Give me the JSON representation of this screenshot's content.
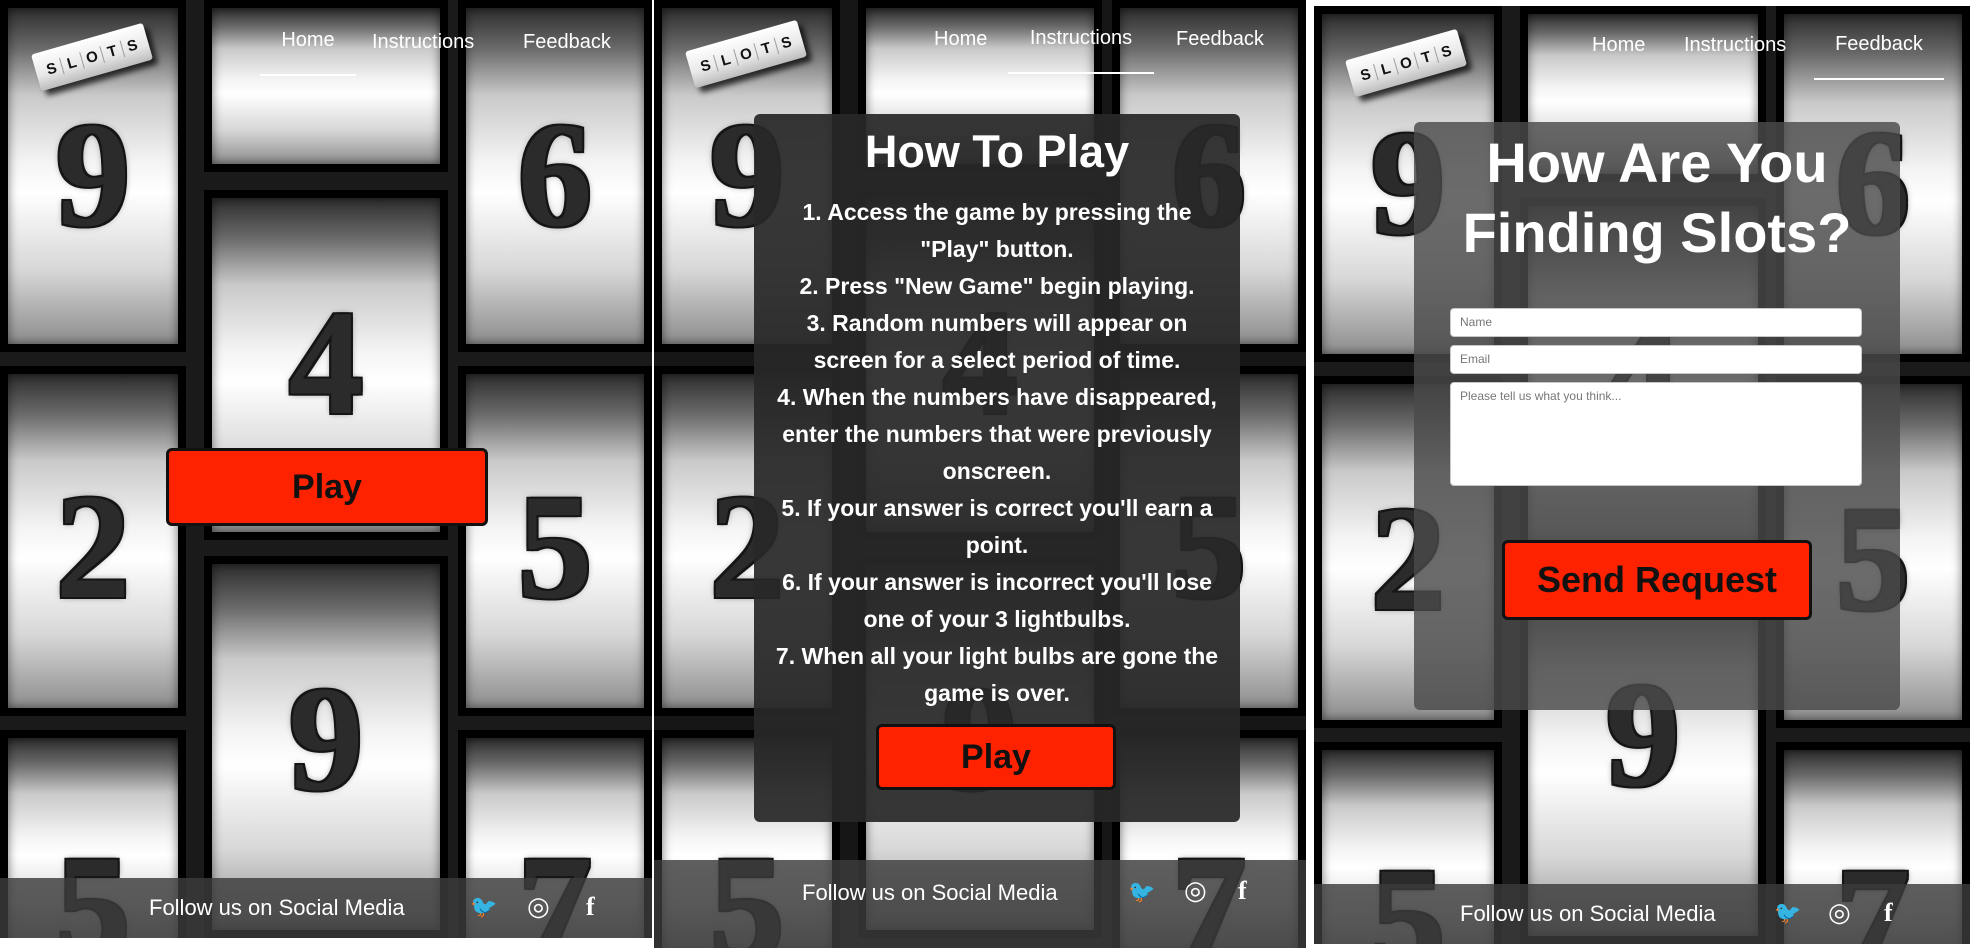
{
  "logo_letters": [
    "S",
    "L",
    "O",
    "T",
    "S"
  ],
  "nav": {
    "home": "Home",
    "instructions": "Instructions",
    "feedback": "Feedback"
  },
  "footer": {
    "follow": "Follow us on Social Media",
    "icons": [
      "twitter-icon",
      "instagram-icon",
      "facebook-icon"
    ]
  },
  "social_glyphs": {
    "twitter": "🐦",
    "instagram": "◎",
    "facebook": "f"
  },
  "home": {
    "digits": [
      "9",
      "6",
      "4",
      "2",
      "5",
      "9",
      "5",
      "7"
    ],
    "play_label": "Play"
  },
  "instructions": {
    "digits": [
      "9",
      "6",
      "4",
      "2",
      "5",
      "9",
      "5",
      "7"
    ],
    "title": "How To Play",
    "steps": [
      "1. Access the game by pressing the \"Play\" button.",
      "2. Press \"New Game\" begin playing.",
      "3. Random numbers will appear on screen for a select period of time.",
      "4. When the numbers have disappeared, enter the numbers that were previously onscreen.",
      "5. If your answer is correct you'll earn a point.",
      "6. If your answer is incorrect you'll lose one of your 3 lightbulbs.",
      "7. When all your light bulbs are gone the game is over."
    ],
    "play_label": "Play"
  },
  "feedback": {
    "digits": [
      "9",
      "6",
      "4",
      "2",
      "5",
      "9",
      "5",
      "7"
    ],
    "title_line1": "How Are You",
    "title_line2": "Finding Slots?",
    "name_placeholder": "Name",
    "email_placeholder": "Email",
    "message_placeholder": "Please tell us what you think...",
    "send_label": "Send Request"
  },
  "colors": {
    "accent": "#ff2200",
    "overlay": "#282828",
    "footer": "#3c3c3c"
  }
}
